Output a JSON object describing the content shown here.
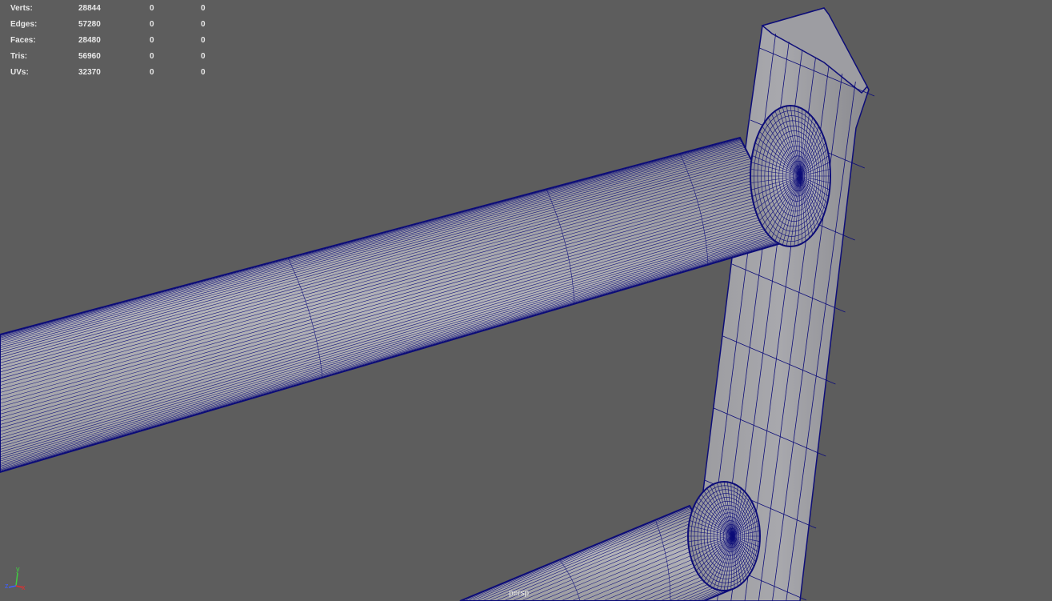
{
  "hud": {
    "rows": [
      {
        "label": "Verts:",
        "v1": "28844",
        "v2": "0",
        "v3": "0"
      },
      {
        "label": "Edges:",
        "v1": "57280",
        "v2": "0",
        "v3": "0"
      },
      {
        "label": "Faces:",
        "v1": "28480",
        "v2": "0",
        "v3": "0"
      },
      {
        "label": "Tris:",
        "v1": "56960",
        "v2": "0",
        "v3": "0"
      },
      {
        "label": "UVs:",
        "v1": "32370",
        "v2": "0",
        "v3": "0"
      }
    ]
  },
  "viewport": {
    "camera_label": "persp",
    "background_color": "#5d5d5d",
    "wireframe_color": "#0d0d78"
  },
  "axis_gizmo": {
    "y_label": "y",
    "z_label": "z",
    "x_label": "x",
    "y_color": "#40d040",
    "z_color": "#4060ff",
    "x_color": "#e03030"
  }
}
